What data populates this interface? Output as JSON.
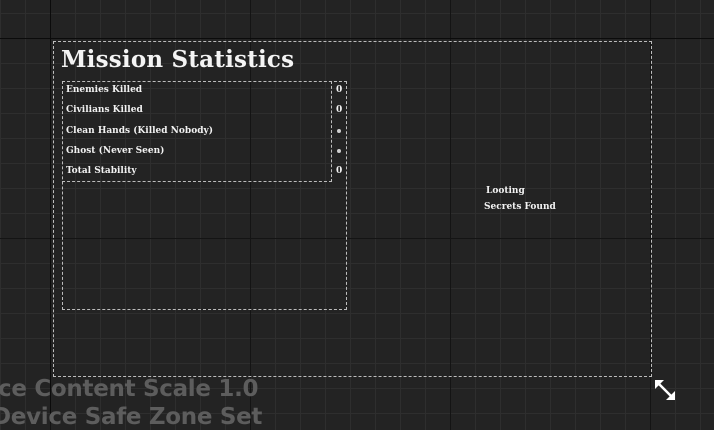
{
  "widget": {
    "title": "Mission Statistics",
    "stats": [
      {
        "label": "Enemies Killed",
        "value": "0"
      },
      {
        "label": "Civilians Killed",
        "value": "0"
      },
      {
        "label": "Clean Hands (Killed Nobody)",
        "value": null,
        "indicator": "dot"
      },
      {
        "label": "Ghost (Never Seen)",
        "value": null,
        "indicator": "dot"
      },
      {
        "label": "Total Stability",
        "value": "0"
      }
    ],
    "looting_label": "Looting",
    "secrets_label": "Secrets Found"
  },
  "viewport_overlay": {
    "content_scale": "ce Content Scale 1.0",
    "safe_zone": "Device Safe Zone Set"
  },
  "icons": {
    "resize": "resize-diagonal-icon"
  },
  "colors": {
    "background": "#232323",
    "text": "#f2f2f2",
    "outline": "#bdbdbd",
    "overlay_text": "#5d5d5d"
  }
}
